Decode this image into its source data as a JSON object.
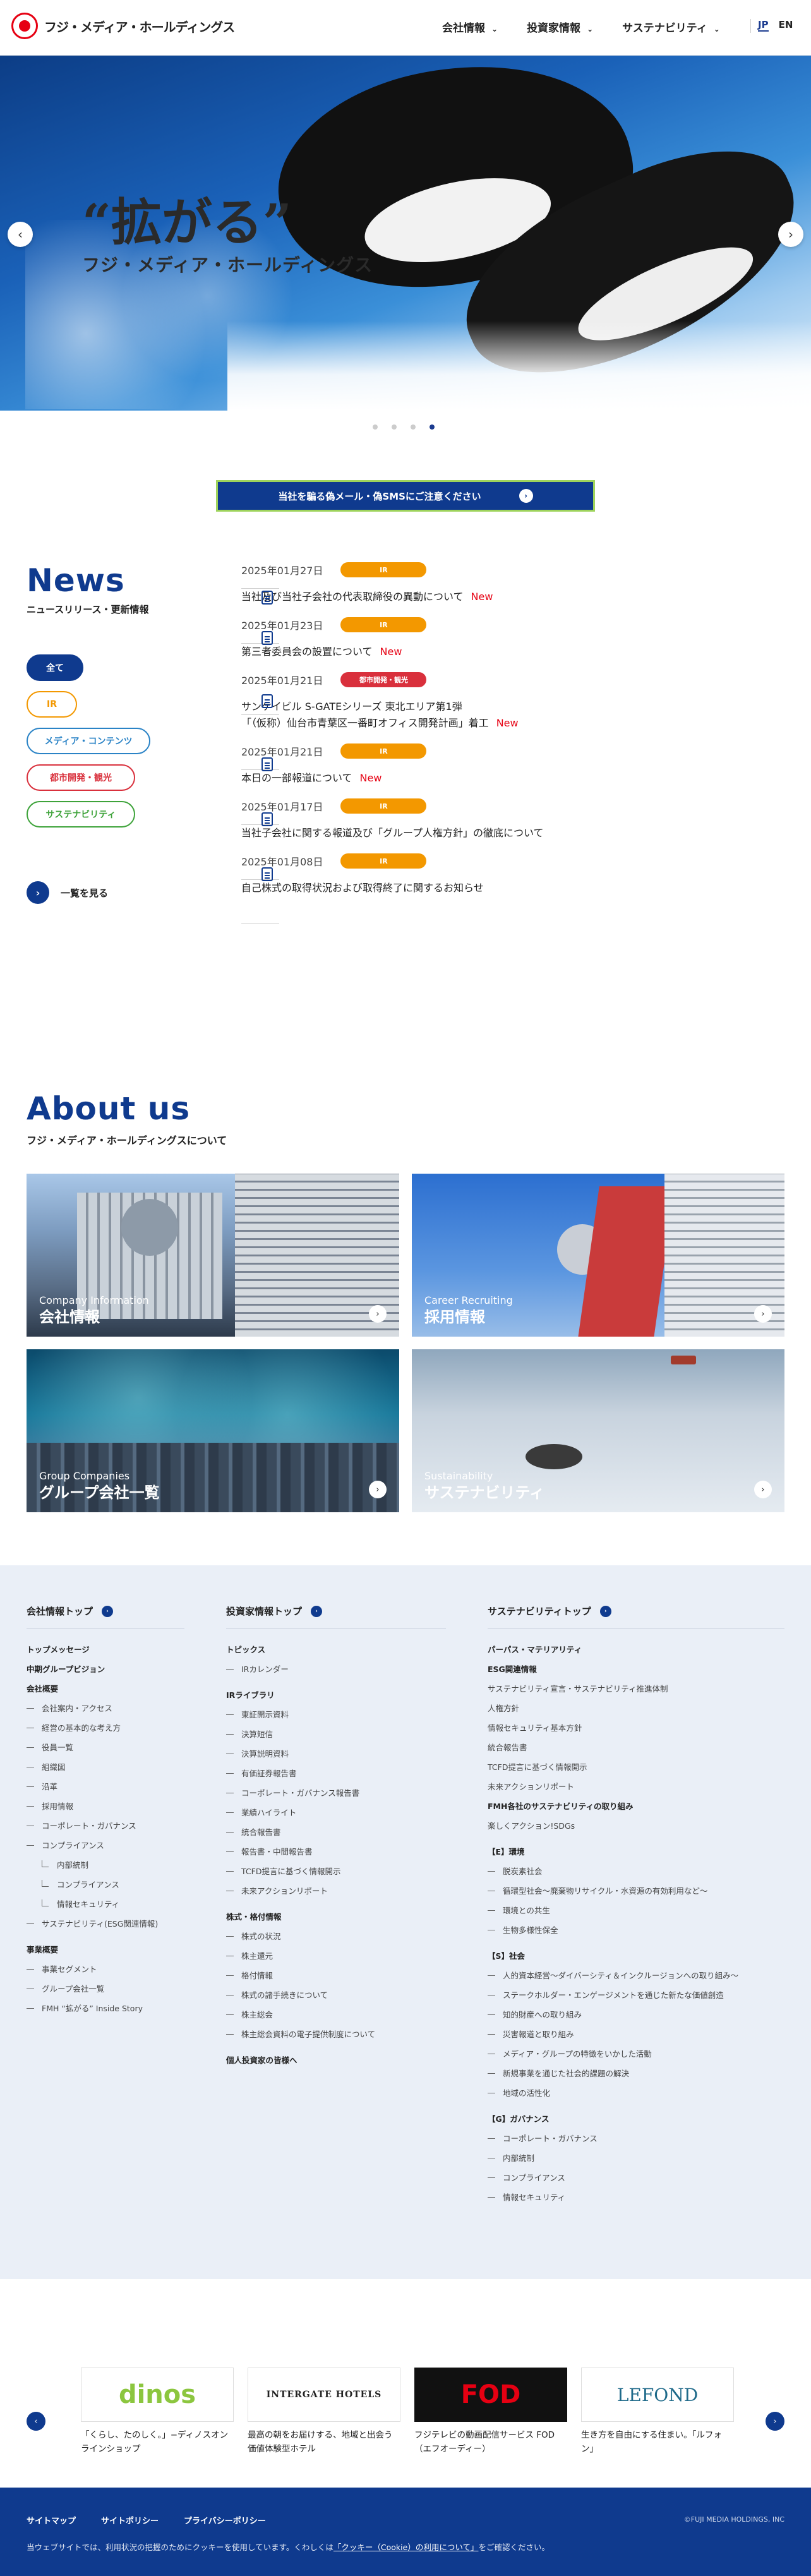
{
  "header": {
    "logo_text": "フジ・メディア・ホールディングス",
    "nav": [
      "会社情報",
      "投資家情報",
      "サステナビリティ"
    ],
    "lang": [
      "JP",
      "EN"
    ]
  },
  "hero": {
    "headline": "“拡がる”",
    "subline": "フジ・メディア・ホールディングス",
    "prev_label": "‹",
    "next_label": "›",
    "slides_count": 4,
    "active_slide": 4
  },
  "notice": {
    "label": "当社を騙る偽メール・偽SMSにご注意ください",
    "arrow": "›"
  },
  "news": {
    "title": "News",
    "subtitle": "ニュースリリース・更新情報",
    "filters": [
      {
        "label": "全て",
        "color": "#0f3a8e",
        "active": true
      },
      {
        "label": "IR",
        "color": "#f39800",
        "active": false
      },
      {
        "label": "メディア・コンテンツ",
        "color": "#2a83c6",
        "active": false
      },
      {
        "label": "都市開発・観光",
        "color": "#d9303c",
        "active": false
      },
      {
        "label": "サステナビリティ",
        "color": "#3ea33a",
        "active": false
      }
    ],
    "view_all": "一覧を見る",
    "items": [
      {
        "date": "2025年01月27日",
        "tag": "IR",
        "tag_color": "#f39800",
        "title": "当社及び当社子会社の代表取締役の異動について",
        "new": "New"
      },
      {
        "date": "2025年01月23日",
        "tag": "IR",
        "tag_color": "#f39800",
        "title": "第三者委員会の設置について",
        "new": "New"
      },
      {
        "date": "2025年01月21日",
        "tag": "都市開発・観光",
        "tag_color": "#d9303c",
        "title": "サンケイビル S-GATEシリーズ 東北エリア第1弾\n「（仮称）仙台市青葉区一番町オフィス開発計画」着工",
        "new": "New"
      },
      {
        "date": "2025年01月21日",
        "tag": "IR",
        "tag_color": "#f39800",
        "title": "本日の一部報道について",
        "new": "New"
      },
      {
        "date": "2025年01月17日",
        "tag": "IR",
        "tag_color": "#f39800",
        "title": "当社子会社に関する報道及び「グループ人権方針」の徹底について",
        "new": ""
      },
      {
        "date": "2025年01月08日",
        "tag": "IR",
        "tag_color": "#f39800",
        "title": "自己株式の取得状況および取得終了に関するお知らせ",
        "new": ""
      }
    ]
  },
  "about": {
    "title": "About us",
    "subtitle": "フジ・メディア・ホールディングスについて",
    "cards": [
      {
        "en": "Company Information",
        "ja": "会社情報"
      },
      {
        "en": "Career Recruiting",
        "ja": "採用情報"
      },
      {
        "en": "Group Companies",
        "ja": "グループ会社一覧"
      },
      {
        "en": "Sustainability",
        "ja": "サステナビリティ"
      }
    ]
  },
  "sitemap": {
    "col1": {
      "head": "会社情報トップ",
      "items": [
        {
          "t": "g",
          "l": "トップメッセージ"
        },
        {
          "t": "g",
          "l": "中期グループビジョン"
        },
        {
          "t": "g",
          "l": "会社概要"
        },
        {
          "t": "s",
          "l": "会社案内・アクセス"
        },
        {
          "t": "s",
          "l": "経営の基本的な考え方"
        },
        {
          "t": "s",
          "l": "役員一覧"
        },
        {
          "t": "s",
          "l": "組織図"
        },
        {
          "t": "s",
          "l": "沿革"
        },
        {
          "t": "s",
          "l": "採用情報"
        },
        {
          "t": "s",
          "l": "コーポレート・ガバナンス"
        },
        {
          "t": "s",
          "l": "コンプライアンス"
        },
        {
          "t": "ss",
          "l": "内部統制"
        },
        {
          "t": "ss",
          "l": "コンプライアンス"
        },
        {
          "t": "ss",
          "l": "情報セキュリティ"
        },
        {
          "t": "s",
          "l": "サステナビリティ(ESG関連情報)"
        },
        {
          "t": "gap",
          "l": ""
        },
        {
          "t": "g",
          "l": "事業概要"
        },
        {
          "t": "s",
          "l": "事業セグメント"
        },
        {
          "t": "s",
          "l": "グループ会社一覧"
        },
        {
          "t": "s",
          "l": "FMH “拡がる” Inside Story"
        }
      ]
    },
    "col2": {
      "head": "投資家情報トップ",
      "items": [
        {
          "t": "g",
          "l": "トピックス"
        },
        {
          "t": "s",
          "l": "IRカレンダー"
        },
        {
          "t": "gap",
          "l": ""
        },
        {
          "t": "g",
          "l": "IRライブラリ"
        },
        {
          "t": "s",
          "l": "東証開示資料"
        },
        {
          "t": "s",
          "l": "決算短信"
        },
        {
          "t": "s",
          "l": "決算説明資料"
        },
        {
          "t": "s",
          "l": "有価証券報告書"
        },
        {
          "t": "s",
          "l": "コーポレート・ガバナンス報告書"
        },
        {
          "t": "s",
          "l": "業績ハイライト"
        },
        {
          "t": "s",
          "l": "統合報告書"
        },
        {
          "t": "s",
          "l": "報告書・中間報告書"
        },
        {
          "t": "s",
          "l": "TCFD提言に基づく情報開示"
        },
        {
          "t": "s",
          "l": "未来アクションリポート"
        },
        {
          "t": "gap",
          "l": ""
        },
        {
          "t": "g",
          "l": "株式・格付情報"
        },
        {
          "t": "s",
          "l": "株式の状況"
        },
        {
          "t": "s",
          "l": "株主還元"
        },
        {
          "t": "s",
          "l": "格付情報"
        },
        {
          "t": "s",
          "l": "株式の諸手続きについて"
        },
        {
          "t": "s",
          "l": "株主総会"
        },
        {
          "t": "s",
          "l": "株主総会資料の電子提供制度について"
        },
        {
          "t": "gap",
          "l": ""
        },
        {
          "t": "g",
          "l": "個人投資家の皆様へ"
        }
      ]
    },
    "col3": {
      "head": "サステナビリティトップ",
      "items": [
        {
          "t": "g",
          "l": "パーパス・マテリアリティ"
        },
        {
          "t": "g",
          "l": "ESG関連情報"
        },
        {
          "t": "p",
          "l": "サステナビリティ宣言・サステナビリティ推進体制"
        },
        {
          "t": "p",
          "l": "人権方針"
        },
        {
          "t": "p",
          "l": "情報セキュリティ基本方針"
        },
        {
          "t": "p",
          "l": "統合報告書"
        },
        {
          "t": "p",
          "l": "TCFD提言に基づく情報開示"
        },
        {
          "t": "p",
          "l": "未来アクションリポート"
        },
        {
          "t": "g",
          "l": "FMH各社のサステナビリティの取り組み"
        },
        {
          "t": "p",
          "l": "楽しくアクション!SDGs"
        },
        {
          "t": "gap",
          "l": ""
        },
        {
          "t": "g",
          "l": "【E】環境"
        },
        {
          "t": "s",
          "l": "脱炭素社会"
        },
        {
          "t": "s",
          "l": "循環型社会～廃棄物リサイクル・水資源の有効利用など～"
        },
        {
          "t": "s",
          "l": "環境との共生"
        },
        {
          "t": "s",
          "l": "生物多様性保全"
        },
        {
          "t": "gap",
          "l": ""
        },
        {
          "t": "g",
          "l": "【S】社会"
        },
        {
          "t": "s",
          "l": "人的資本経営～ダイバーシティ＆インクルージョンへの取り組み～"
        },
        {
          "t": "s",
          "l": "ステークホルダー・エンゲージメントを通じた新たな価値創造"
        },
        {
          "t": "s",
          "l": "知的財産への取り組み"
        },
        {
          "t": "s",
          "l": "災害報道と取り組み"
        },
        {
          "t": "s",
          "l": "メディア・グループの特徴をいかした活動"
        },
        {
          "t": "s",
          "l": "新規事業を通じた社会的課題の解決"
        },
        {
          "t": "s",
          "l": "地域の活性化"
        },
        {
          "t": "gap",
          "l": ""
        },
        {
          "t": "g",
          "l": "【G】ガバナンス"
        },
        {
          "t": "s",
          "l": "コーポレート・ガバナンス"
        },
        {
          "t": "s",
          "l": "内部統制"
        },
        {
          "t": "s",
          "l": "コンプライアンス"
        },
        {
          "t": "s",
          "l": "情報セキュリティ"
        }
      ]
    }
  },
  "banners": {
    "prev": "‹",
    "next": "›",
    "items": [
      {
        "logo": "dinos",
        "caption": "「くらし、たのしく。」−ディノスオンラインショップ"
      },
      {
        "logo": "INTERGATE HOTELS",
        "caption": "最高の朝をお届けする、地域と出会う価値体験型ホテル"
      },
      {
        "logo": "FOD",
        "caption": "フジテレビの動画配信サービス FOD（エフオーディー）"
      },
      {
        "logo": "LEFOND",
        "caption": "生き方を自由にする住まい。「ルフォン」"
      }
    ]
  },
  "footer": {
    "links": [
      "サイトマップ",
      "サイトポリシー",
      "プライバシーポリシー"
    ],
    "copyright": "©FUJI MEDIA HOLDINGS, INC",
    "note_before": "当ウェブサイトでは、利用状況の把握のためにクッキーを使用しています。くわしくは",
    "note_link": "「クッキー（Cookie）の利用について」",
    "note_after": "をご確認ください。"
  },
  "colors": {
    "brand_blue": "#0f3a8e",
    "brand_red": "#e60012",
    "ir_orange": "#f39800"
  }
}
